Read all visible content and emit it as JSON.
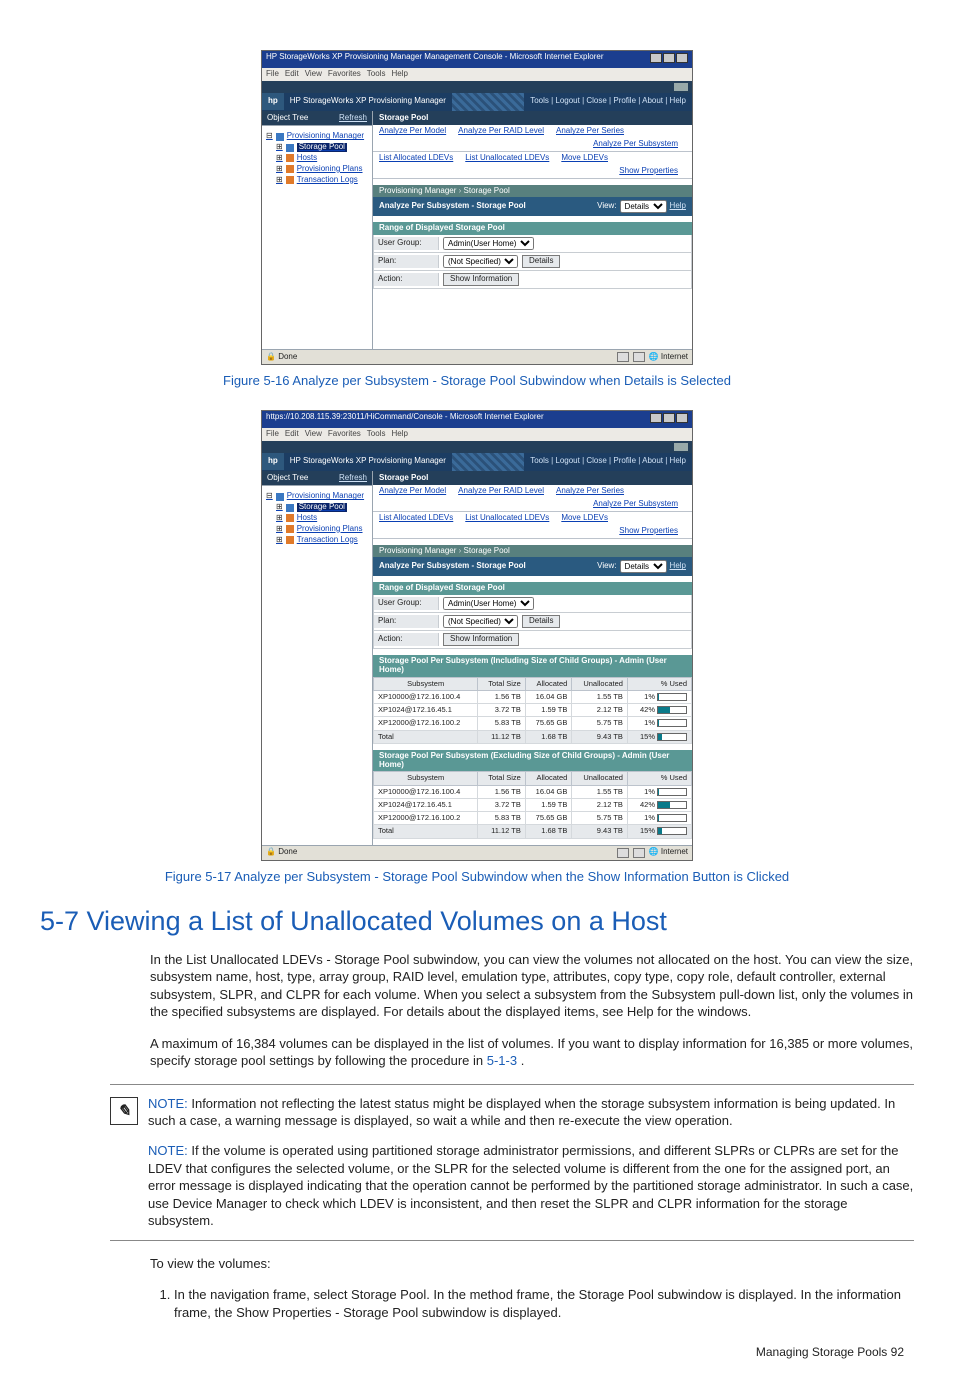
{
  "window": {
    "title1": "HP StorageWorks XP Provisioning Manager Management Console - Microsoft Internet Explorer",
    "title2": "https://10.208.115.39:23011/HiCommand/Console - Microsoft Internet Explorer",
    "menu": [
      "File",
      "Edit",
      "View",
      "Favorites",
      "Tools",
      "Help"
    ],
    "status_done": "Done",
    "status_zone": "Internet"
  },
  "app": {
    "logo": "hp",
    "name": "HP StorageWorks XP Provisioning Manager",
    "links": "Tools | Logout | Close | Profile | About | Help"
  },
  "sidebar": {
    "title": "Object Tree",
    "refresh": "Refresh",
    "items": [
      {
        "label": "Provisioning Manager"
      },
      {
        "label": "Storage Pool",
        "selected": true
      },
      {
        "label": "Hosts"
      },
      {
        "label": "Provisioning Plans"
      },
      {
        "label": "Transaction Logs"
      }
    ]
  },
  "main": {
    "head": "Storage Pool",
    "links_row1": [
      "Analyze Per Model",
      "Analyze Per RAID Level",
      "Analyze Per Series"
    ],
    "link_right": "Analyze Per Subsystem",
    "links_row2": [
      "List Allocated LDEVs",
      "List Unallocated LDEVs",
      "Move LDEVs"
    ],
    "link_right2": "Show Properties",
    "crumb_a": "Provisioning Manager",
    "crumb_b": "Storage Pool",
    "subhdr": "Analyze Per Subsystem - Storage Pool",
    "view_label": "View:",
    "view_value": "Details",
    "help": "Help",
    "range_hdr": "Range of Displayed Storage Pool",
    "form": {
      "ug_label": "User Group:",
      "ug_value": "Admin(User Home)",
      "plan_label": "Plan:",
      "plan_value": "(Not Specified)",
      "details_btn": "Details",
      "action_label": "Action:",
      "show_info": "Show Information"
    }
  },
  "chart_data": [
    {
      "type": "table",
      "title": "Storage Pool Per Subsystem (Including Size of Child Groups) - Admin (User Home)",
      "columns": [
        "Subsystem",
        "Total Size",
        "Allocated",
        "Unallocated",
        "% Used"
      ],
      "rows": [
        [
          "XP10000@172.16.100.4",
          "1.56 TB",
          "16.04 GB",
          "1.55 TB",
          "1%"
        ],
        [
          "XP1024@172.16.45.1",
          "3.72 TB",
          "1.59 TB",
          "2.12 TB",
          "42%"
        ],
        [
          "XP12000@172.16.100.2",
          "5.83 TB",
          "75.65 GB",
          "5.75 TB",
          "1%"
        ],
        [
          "Total",
          "11.12 TB",
          "1.68 TB",
          "9.43 TB",
          "15%"
        ]
      ],
      "pct": [
        1,
        42,
        1,
        15
      ]
    },
    {
      "type": "table",
      "title": "Storage Pool Per Subsystem (Excluding Size of Child Groups) - Admin (User Home)",
      "columns": [
        "Subsystem",
        "Total Size",
        "Allocated",
        "Unallocated",
        "% Used"
      ],
      "rows": [
        [
          "XP10000@172.16.100.4",
          "1.56 TB",
          "16.04 GB",
          "1.55 TB",
          "1%"
        ],
        [
          "XP1024@172.16.45.1",
          "3.72 TB",
          "1.59 TB",
          "2.12 TB",
          "42%"
        ],
        [
          "XP12000@172.16.100.2",
          "5.83 TB",
          "75.65 GB",
          "5.75 TB",
          "1%"
        ],
        [
          "Total",
          "11.12 TB",
          "1.68 TB",
          "9.43 TB",
          "15%"
        ]
      ],
      "pct": [
        1,
        42,
        1,
        15
      ]
    }
  ],
  "captions": {
    "c16": "Figure 5-16 Analyze per Subsystem - Storage Pool Subwindow when Details is Selected",
    "c17": "Figure 5-17 Analyze per Subsystem - Storage Pool Subwindow when the Show Information Button is Clicked"
  },
  "section": {
    "heading": "5-7 Viewing a List of Unallocated Volumes on a Host",
    "p1": "In the List Unallocated LDEVs - Storage Pool subwindow, you can view the volumes not allocated on the host. You can view the size, subsystem name, host, type, array group, RAID level, emulation type, attributes, copy type, copy role, default controller, external subsystem, SLPR, and CLPR for each volume. When you select a subsystem from the Subsystem pull-down list, only the volumes in the specified subsystems are displayed. For details about the displayed items, see Help for the windows.",
    "p2a": "A maximum of 16,384 volumes can be displayed in the list of volumes. If you want to display information for 16,385 or more volumes, specify storage pool settings by following the procedure in ",
    "p2link": "5-1-3",
    "p2b": " .",
    "note1_label": "NOTE:",
    "note1": "  Information not reflecting the latest status might be displayed when the storage subsystem information is being updated. In such a case, a warning message is displayed, so wait a while and then re-execute the view operation.",
    "note2": "  If the volume is operated using partitioned storage administrator permissions, and different SLPRs or CLPRs are set for the LDEV that configures the selected volume, or the SLPR for the selected volume is different from the one for the assigned port, an error message is displayed indicating that the operation cannot be performed by the partitioned storage administrator. In such a case, use Device Manager to check which LDEV is inconsistent, and then reset the SLPR and CLPR information for the storage subsystem.",
    "proc_intro": "To view the volumes:",
    "step1": "In the navigation frame, select Storage Pool. In the method frame, the Storage Pool subwindow is displayed. In the information frame, the Show Properties - Storage Pool subwindow is displayed.",
    "footer": "Managing Storage Pools  92"
  }
}
